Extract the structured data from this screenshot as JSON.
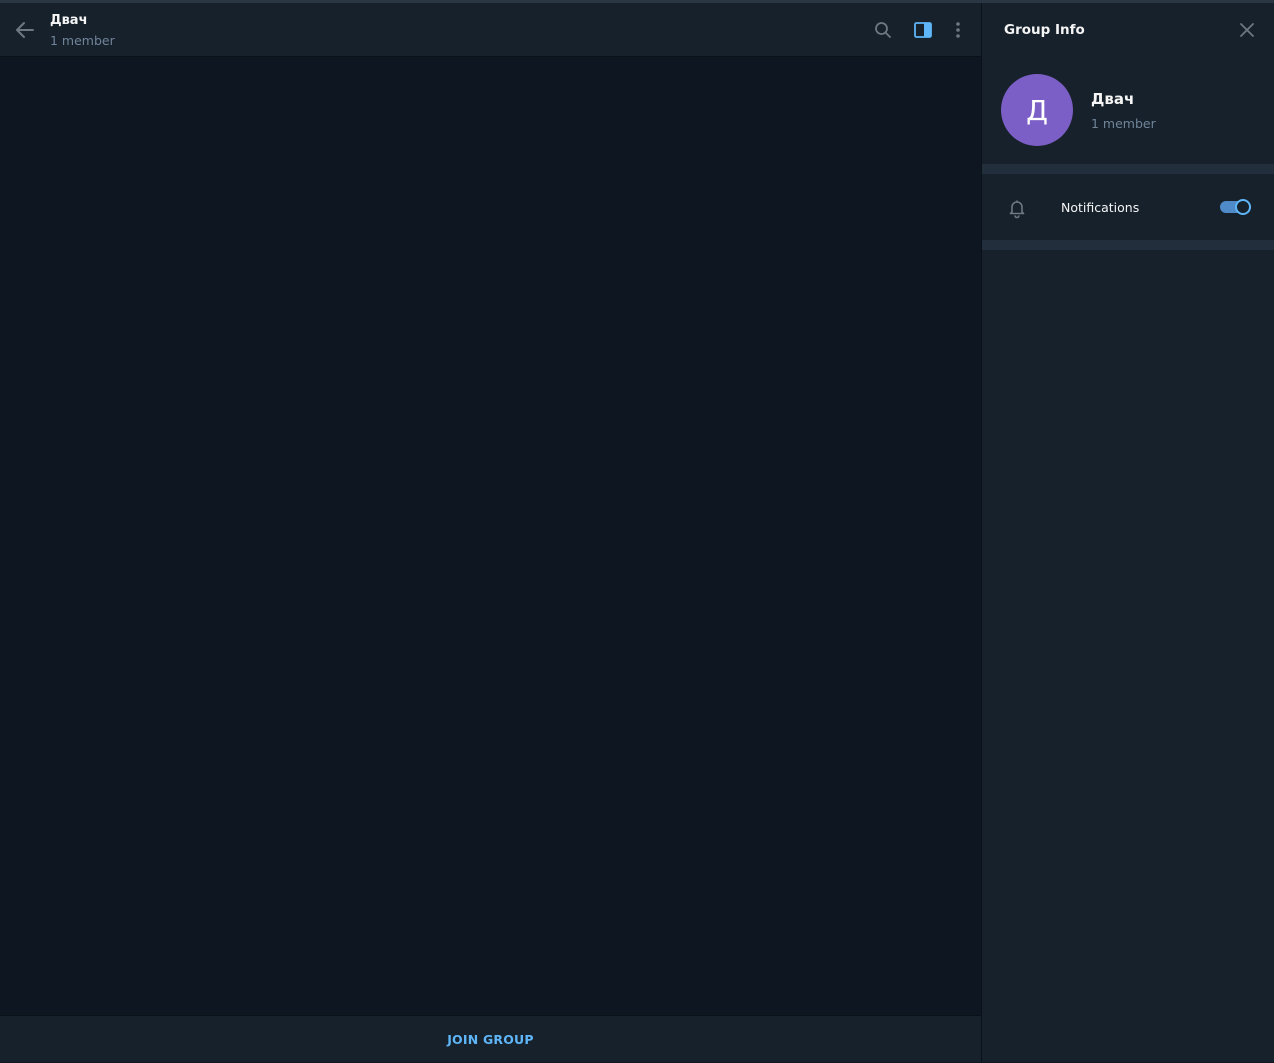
{
  "chat": {
    "title": "Двач",
    "subtitle": "1 member",
    "join_label": "JOIN GROUP"
  },
  "panel": {
    "title": "Group Info",
    "avatar_letter": "Д",
    "group_name": "Двач",
    "group_sub": "1 member",
    "notifications_label": "Notifications",
    "notifications_on": true
  },
  "colors": {
    "accent": "#5eb5f7",
    "avatar": "#7b5fc6",
    "background": "#0e1621",
    "header": "#17212b"
  },
  "icons": {
    "back": "arrow-left-icon",
    "search": "search-icon",
    "panel": "sidebar-toggle-icon",
    "more": "more-vertical-icon",
    "close": "close-icon",
    "bell": "bell-icon"
  }
}
